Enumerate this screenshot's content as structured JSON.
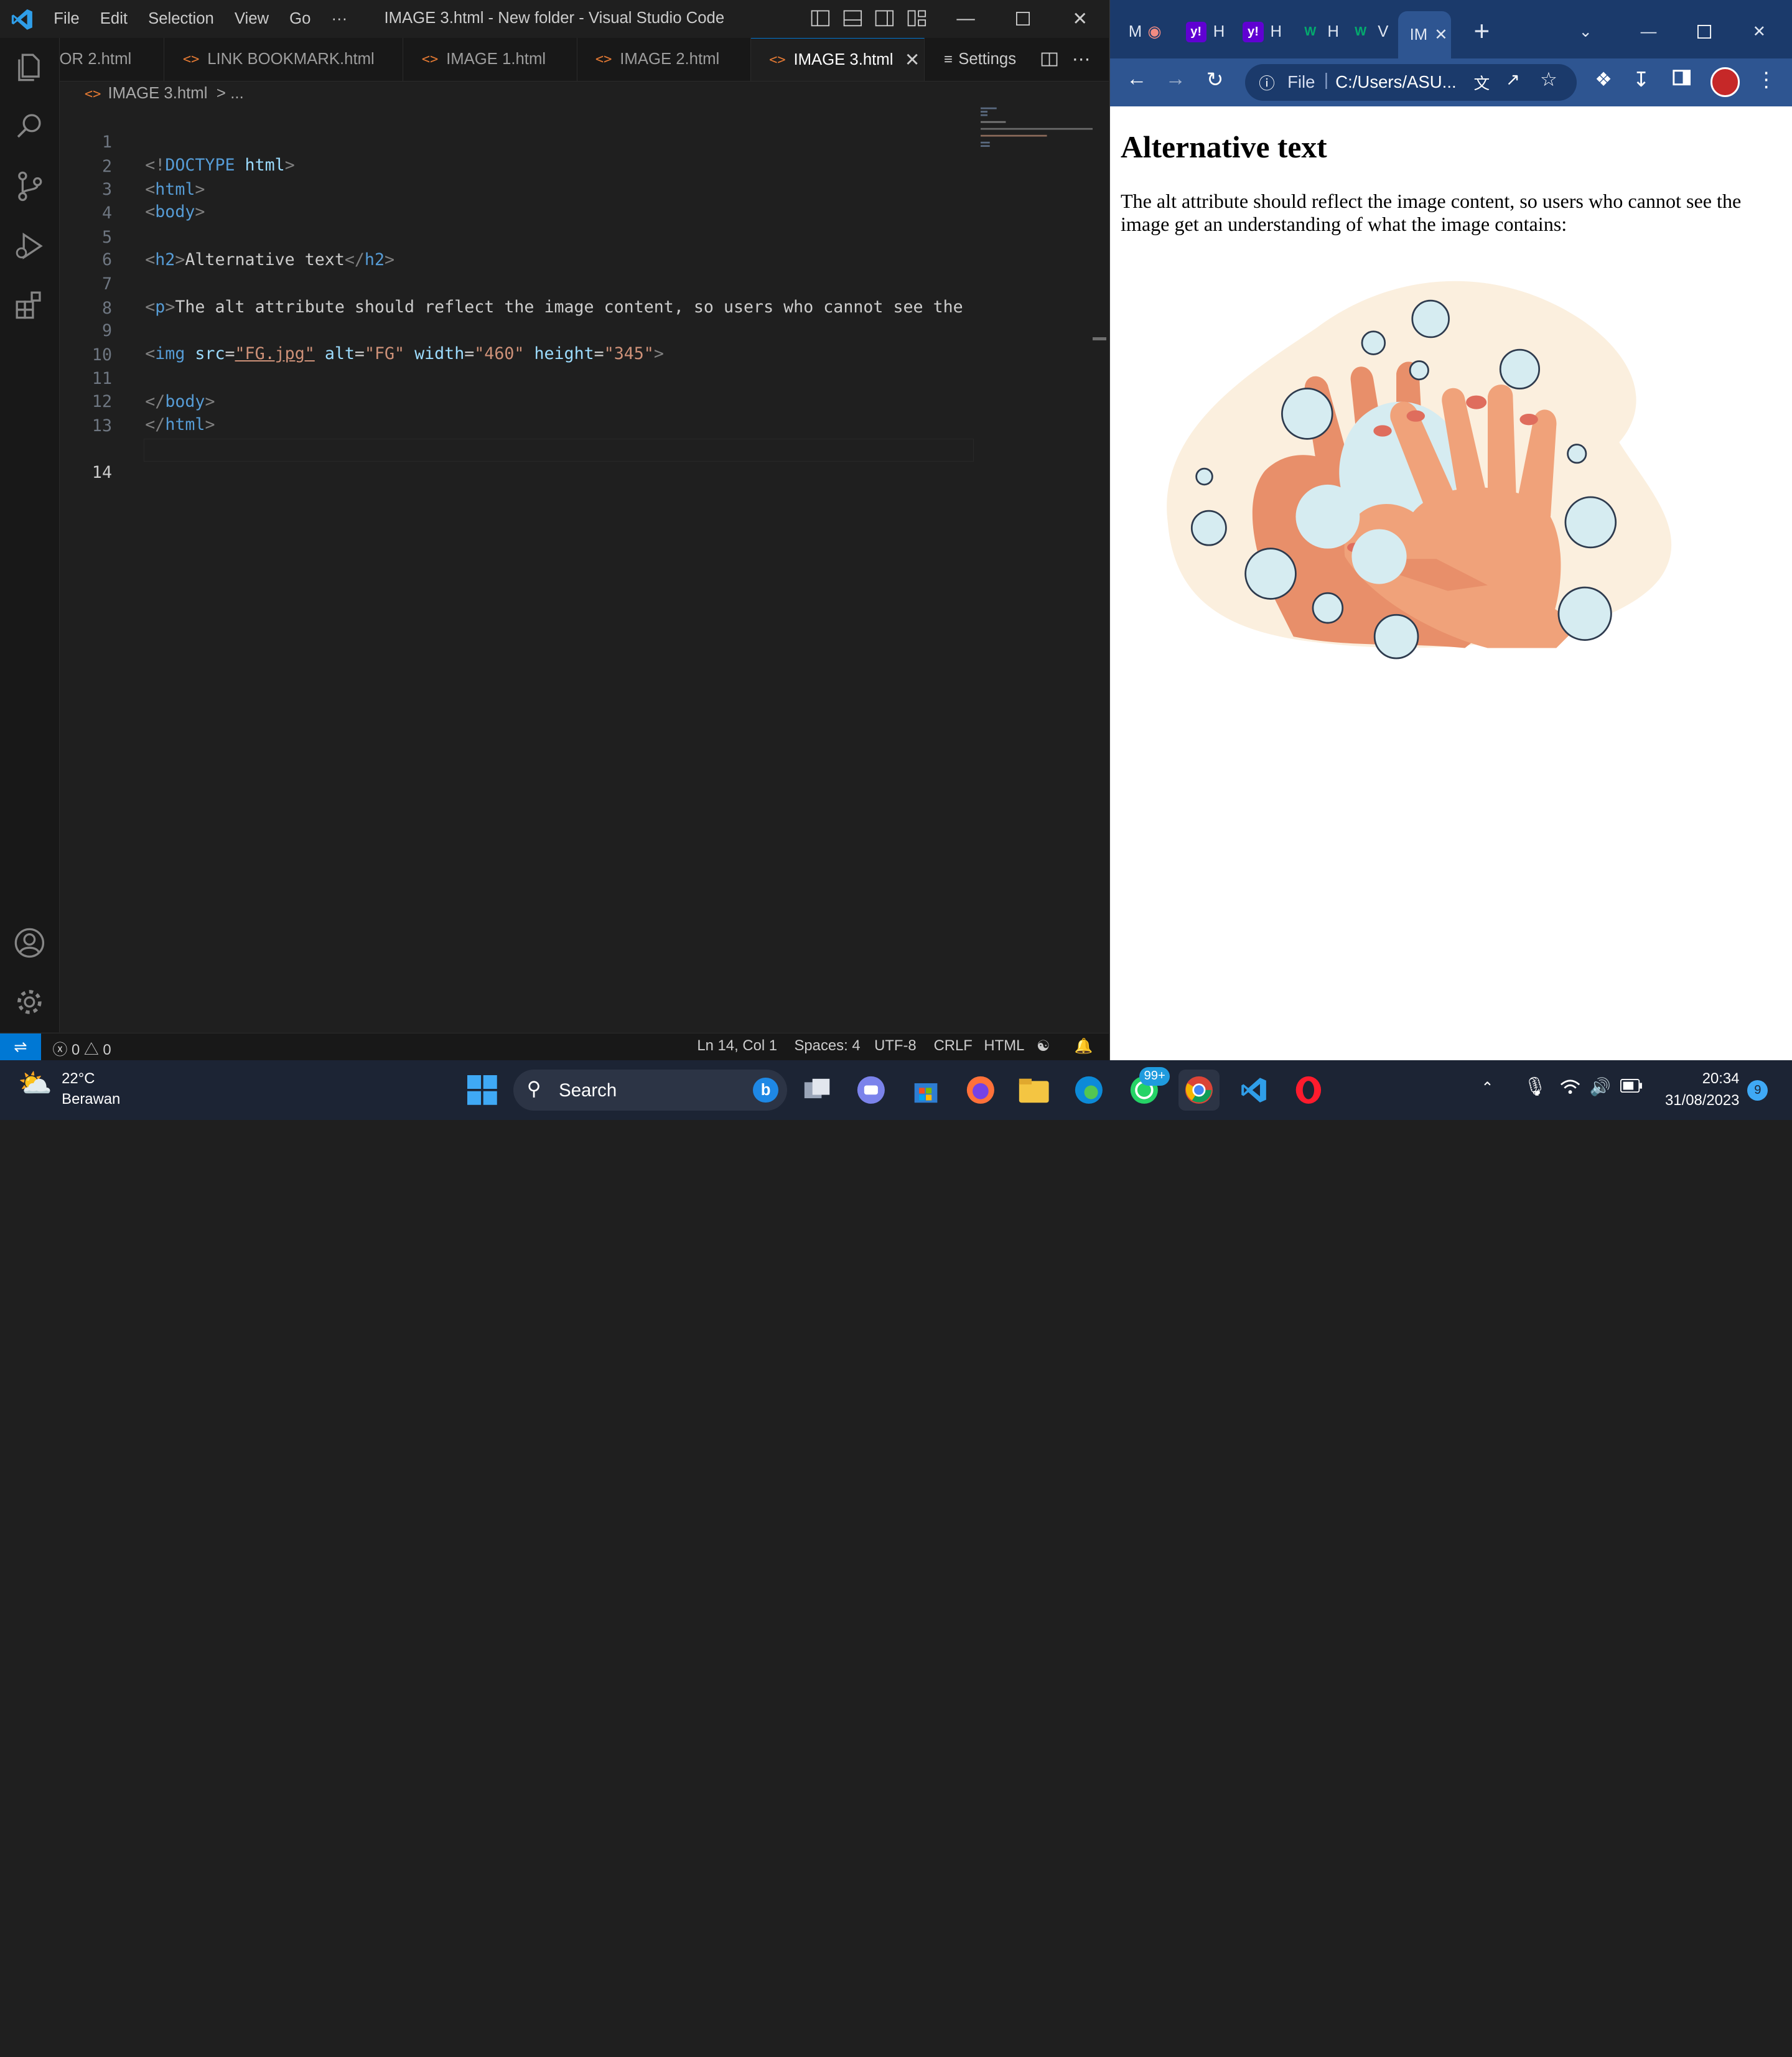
{
  "vscode": {
    "window_title": "IMAGE 3.html - New folder - Visual Studio Code",
    "menu": [
      "File",
      "Edit",
      "Selection",
      "View",
      "Go",
      "···"
    ],
    "tabs": [
      {
        "label": "OR 2.html",
        "active": false
      },
      {
        "label": "LINK BOOKMARK.html",
        "active": false
      },
      {
        "label": "IMAGE 1.html",
        "active": false
      },
      {
        "label": "IMAGE 2.html",
        "active": false
      },
      {
        "label": "IMAGE 3.html",
        "active": true
      }
    ],
    "tab_settings_label": "Settings",
    "breadcrumb": {
      "file": "IMAGE 3.html",
      "sep": ">",
      "rest": "..."
    },
    "line_numbers": [
      "1",
      "2",
      "3",
      "4",
      "5",
      "6",
      "7",
      "8",
      "9",
      "10",
      "11",
      "12",
      "13",
      "14"
    ],
    "current_line": "14",
    "code": {
      "l1": {
        "open": "<!",
        "kw": "DOCTYPE",
        "val": " html",
        "close": ">"
      },
      "l2": {
        "tag": "html"
      },
      "l3": {
        "tag": "body"
      },
      "l5": {
        "tag": "h2",
        "text": "Alternative text"
      },
      "l7": {
        "tag": "p",
        "text": "The alt attribute should reflect the image content, so users who cannot see the imag"
      },
      "l9": {
        "tag": "img",
        "src_attr": "src",
        "src_val": "\"FG.jpg\"",
        "alt_attr": "alt",
        "alt_val": "\"FG\"",
        "w_attr": "width",
        "w_val": "\"460\"",
        "h_attr": "height",
        "h_val": "\"345\""
      },
      "l11": {
        "tag": "body"
      },
      "l12": {
        "tag": "html"
      }
    },
    "status": {
      "errors": "0",
      "warnings": "0",
      "position": "Ln 14, Col 1",
      "spaces": "Spaces: 4",
      "encoding": "UTF-8",
      "eol": "CRLF",
      "language": "HTML"
    }
  },
  "chrome": {
    "tabs": [
      "M",
      "H",
      "H",
      "H",
      "V",
      "IM"
    ],
    "address": "C:/Users/ASU...",
    "address_prefix": "File",
    "page": {
      "heading": "Alternative text",
      "paragraph": "The alt attribute should reflect the image content, so users who cannot see the image get an understanding of what the image contains:"
    }
  },
  "taskbar": {
    "temperature": "22°C",
    "weather_desc": "Berawan",
    "search_placeholder": "Search",
    "whatsapp_badge": "99+",
    "time": "20:34",
    "date": "31/08/2023",
    "notification_count": "9"
  },
  "colors": {
    "vscode_bg": "#1f1f1f",
    "accent": "#0078d4",
    "html_tag": "#569cd6",
    "attr": "#9cdcfe",
    "string": "#ce9178",
    "chrome_frame": "#1b3a6b"
  }
}
